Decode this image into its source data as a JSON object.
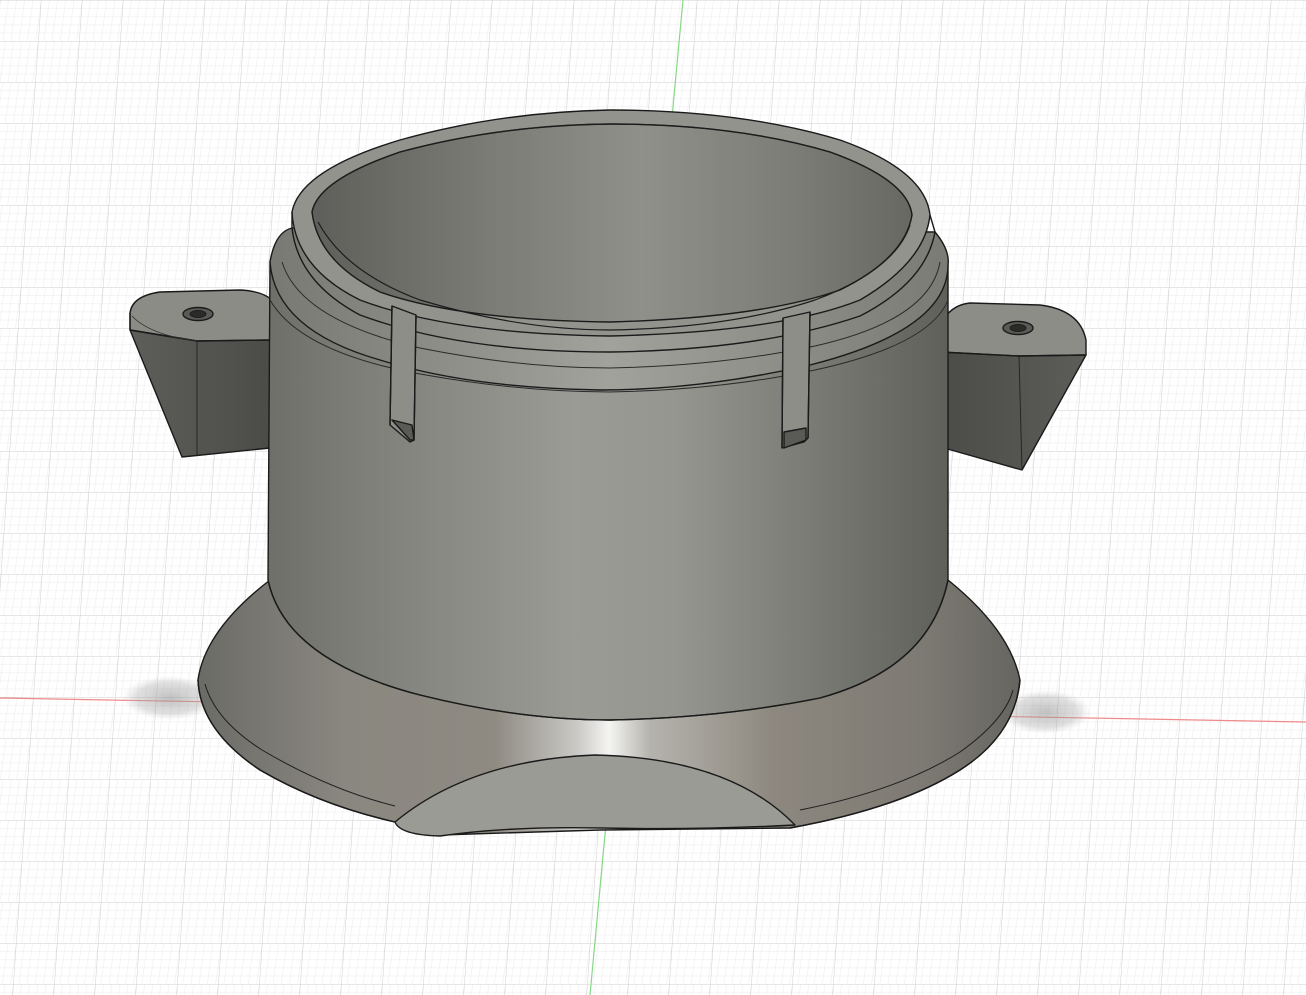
{
  "app": {
    "view": "3d-viewport",
    "background_color": "#ffffff",
    "grid": {
      "visible": true,
      "minor_color": "#e4e4e4",
      "major_color": "#c9c9c9"
    },
    "axes": {
      "x_color": "#f07a7a",
      "y_color": "#7ad67a"
    }
  },
  "model": {
    "name_icon": "cad-body",
    "body_color": "#8a8a84",
    "edge_color": "#1a1a1a",
    "features": [
      "cylinder-wall",
      "top-lip",
      "two-mounting-tabs",
      "mounting-holes",
      "flared-base",
      "base-cutout",
      "two-slot-clips"
    ]
  }
}
